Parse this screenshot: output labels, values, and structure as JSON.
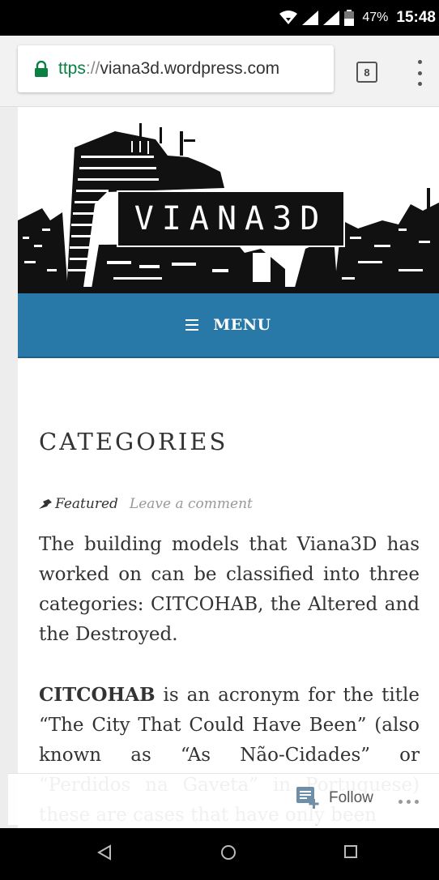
{
  "status_bar": {
    "battery_percent": "47%",
    "time": "15:48"
  },
  "browser": {
    "url_scheme": "ttps",
    "url_separator": "://",
    "url_host": "viana3d.wordpress.com",
    "tab_count": "8"
  },
  "site": {
    "logo_text": "VIANA3D",
    "menu_label": "MENU"
  },
  "post": {
    "title": "CATEGORIES",
    "featured_label": "Featured",
    "comment_link": "Leave a comment",
    "paragraph1": "The building models that Viana3D has worked on can be classified into three categories: CITCOHAB, the Altered and the Destroyed.",
    "paragraph2_bold": "CITCOHAB",
    "paragraph2_rest": " is an acronym for the title “The City That Could Have Been” (also known as “As Não-Cidades” or “Perdidos na Gaveta” in Portuguese) these are cases that have only been"
  },
  "follow_bar": {
    "follow_label": "Follow"
  },
  "colors": {
    "menu_bar": "#2878a8",
    "lock_green": "#0b8043"
  }
}
